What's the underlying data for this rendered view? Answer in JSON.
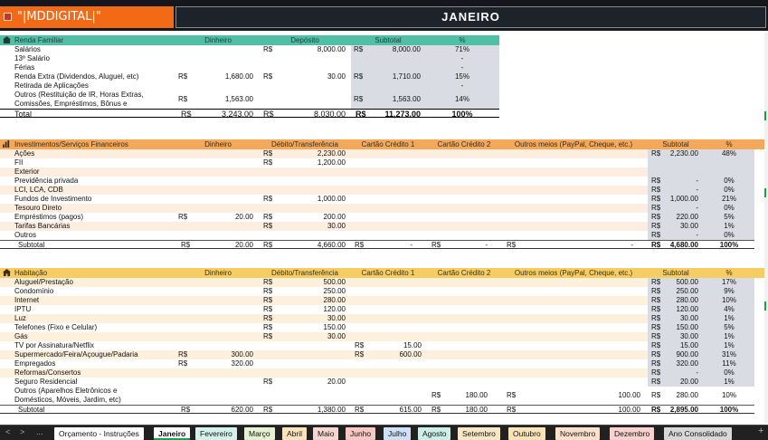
{
  "header": {
    "brand": "\"|MDDIGITAL|\"",
    "month": "JANEIRO"
  },
  "renda": {
    "title": "Renda Familiar",
    "columns": {
      "dinheiro": "Dinheiro",
      "deposito": "Depósito",
      "subtotal": "Subtotal",
      "pct": "%"
    },
    "rows": [
      {
        "label": "Salários",
        "din_cur": "",
        "din": "",
        "dep_cur": "R$",
        "dep": "8,000.00",
        "sub_cur": "R$",
        "sub": "8,000.00",
        "pct": "71%"
      },
      {
        "label": "13º Salário",
        "din_cur": "",
        "din": "",
        "dep_cur": "",
        "dep": "",
        "sub_cur": "",
        "sub": "",
        "pct": "-"
      },
      {
        "label": "Férias",
        "din_cur": "",
        "din": "",
        "dep_cur": "",
        "dep": "",
        "sub_cur": "",
        "sub": "",
        "pct": "-"
      },
      {
        "label": "Renda Extra (Dividendos, Aluguel, etc)",
        "din_cur": "R$",
        "din": "1,680.00",
        "dep_cur": "R$",
        "dep": "30.00",
        "sub_cur": "R$",
        "sub": "1,710.00",
        "pct": "15%"
      },
      {
        "label": "Retirada de Aplicações",
        "din_cur": "",
        "din": "",
        "dep_cur": "",
        "dep": "",
        "sub_cur": "",
        "sub": "",
        "pct": "-"
      }
    ],
    "outros": {
      "line1": "Outros (Restituição de IR, Horas Extras,",
      "line2": "Comissões, Empréstimos, Bônus e",
      "din_cur": "R$",
      "din": "1,563.00",
      "sub_cur": "R$",
      "sub": "1,563.00",
      "pct": "14%"
    },
    "total": {
      "label": "Total",
      "din_cur": "R$",
      "din": "3,243.00",
      "dep_cur": "R$",
      "dep": "8,030.00",
      "sub_cur": "R$",
      "sub": "11,273.00",
      "pct": "100%"
    }
  },
  "invest": {
    "title": "Investimentos/Serviços Financeiros",
    "columns": {
      "dinheiro": "Dinheiro",
      "debito": "Débito/Transferência",
      "cc1": "Cartão Crédito 1",
      "cc2": "Cartão Crédito 2",
      "outros": "Outros meios (PayPal, Cheque, etc.)",
      "subtotal": "Subtotal",
      "pct": "%"
    },
    "rows": [
      {
        "label": "Ações",
        "din_cur": "",
        "din": "",
        "deb_cur": "R$",
        "deb": "2,230.00",
        "sub_cur": "R$",
        "sub": "2,230.00",
        "pct": "48%"
      },
      {
        "label": "FII",
        "din_cur": "",
        "din": "",
        "deb_cur": "R$",
        "deb": "1,200.00",
        "sub_cur": "",
        "sub": "",
        "pct": ""
      },
      {
        "label": "Exterior",
        "din_cur": "",
        "din": "",
        "deb_cur": "",
        "deb": "",
        "sub_cur": "",
        "sub": "",
        "pct": ""
      },
      {
        "label": "Previdência privada",
        "din_cur": "",
        "din": "",
        "deb_cur": "",
        "deb": "",
        "sub_cur": "R$",
        "sub": "-",
        "pct": "0%"
      },
      {
        "label": "LCI, LCA, CDB",
        "din_cur": "",
        "din": "",
        "deb_cur": "",
        "deb": "",
        "sub_cur": "R$",
        "sub": "-",
        "pct": "0%"
      },
      {
        "label": "Fundos de Investimento",
        "din_cur": "",
        "din": "",
        "deb_cur": "R$",
        "deb": "1,000.00",
        "sub_cur": "R$",
        "sub": "1,000.00",
        "pct": "21%"
      },
      {
        "label": "Tesouro Direto",
        "din_cur": "",
        "din": "",
        "deb_cur": "",
        "deb": "",
        "sub_cur": "R$",
        "sub": "-",
        "pct": "0%"
      },
      {
        "label": "Empréstimos (pagos)",
        "din_cur": "R$",
        "din": "20.00",
        "deb_cur": "R$",
        "deb": "200.00",
        "sub_cur": "R$",
        "sub": "220.00",
        "pct": "5%"
      },
      {
        "label": "Tarifas Bancárias",
        "din_cur": "",
        "din": "",
        "deb_cur": "R$",
        "deb": "30.00",
        "sub_cur": "R$",
        "sub": "30.00",
        "pct": "1%"
      },
      {
        "label": "Outros",
        "din_cur": "",
        "din": "",
        "deb_cur": "",
        "deb": "",
        "sub_cur": "R$",
        "sub": "-",
        "pct": "0%"
      }
    ],
    "subtotal": {
      "label": "Subtotal",
      "din_cur": "R$",
      "din": "20.00",
      "deb_cur": "R$",
      "deb": "4,660.00",
      "cc1_cur": "R$",
      "cc1": "-",
      "cc2_cur": "R$",
      "cc2": "-",
      "out_cur": "R$",
      "out": "-",
      "sub_cur": "R$",
      "sub": "4,680.00",
      "pct": "100%"
    }
  },
  "hab": {
    "title": "Habitação",
    "columns": {
      "dinheiro": "Dinheiro",
      "debito": "Débito/Transferência",
      "cc1": "Cartão Crédito 1",
      "cc2": "Cartão Crédito 2",
      "outros": "Outros meios (PayPal, Cheque, etc.)",
      "subtotal": "Subtotal",
      "pct": "%"
    },
    "rows": [
      {
        "label": "Aluguel/Prestação",
        "din_cur": "",
        "din": "",
        "deb_cur": "R$",
        "deb": "500.00",
        "cc1_cur": "",
        "cc1": "",
        "sub_cur": "R$",
        "sub": "500.00",
        "pct": "17%"
      },
      {
        "label": "Condomínio",
        "din_cur": "",
        "din": "",
        "deb_cur": "R$",
        "deb": "250.00",
        "cc1_cur": "",
        "cc1": "",
        "sub_cur": "R$",
        "sub": "250.00",
        "pct": "9%"
      },
      {
        "label": "Internet",
        "din_cur": "",
        "din": "",
        "deb_cur": "R$",
        "deb": "280.00",
        "cc1_cur": "",
        "cc1": "",
        "sub_cur": "R$",
        "sub": "280.00",
        "pct": "10%"
      },
      {
        "label": "IPTU",
        "din_cur": "",
        "din": "",
        "deb_cur": "R$",
        "deb": "120.00",
        "cc1_cur": "",
        "cc1": "",
        "sub_cur": "R$",
        "sub": "120.00",
        "pct": "4%"
      },
      {
        "label": "Luz",
        "din_cur": "",
        "din": "",
        "deb_cur": "R$",
        "deb": "30.00",
        "cc1_cur": "",
        "cc1": "",
        "sub_cur": "R$",
        "sub": "30.00",
        "pct": "1%"
      },
      {
        "label": "Telefones (Fixo e Celular)",
        "din_cur": "",
        "din": "",
        "deb_cur": "R$",
        "deb": "150.00",
        "cc1_cur": "",
        "cc1": "",
        "sub_cur": "R$",
        "sub": "150.00",
        "pct": "5%"
      },
      {
        "label": "Gás",
        "din_cur": "",
        "din": "",
        "deb_cur": "R$",
        "deb": "30.00",
        "cc1_cur": "",
        "cc1": "",
        "sub_cur": "R$",
        "sub": "30.00",
        "pct": "1%"
      },
      {
        "label": "TV por Assinatura/Netflix",
        "din_cur": "",
        "din": "",
        "deb_cur": "",
        "deb": "",
        "cc1_cur": "R$",
        "cc1": "15.00",
        "sub_cur": "R$",
        "sub": "15.00",
        "pct": "1%"
      },
      {
        "label": "Supermercado/Feira/Açougue/Padaria",
        "din_cur": "R$",
        "din": "300.00",
        "deb_cur": "",
        "deb": "",
        "cc1_cur": "R$",
        "cc1": "600.00",
        "sub_cur": "R$",
        "sub": "900.00",
        "pct": "31%"
      },
      {
        "label": "Empregados",
        "din_cur": "R$",
        "din": "320.00",
        "deb_cur": "",
        "deb": "",
        "cc1_cur": "",
        "cc1": "",
        "sub_cur": "R$",
        "sub": "320.00",
        "pct": "11%"
      },
      {
        "label": "Reformas/Consertos",
        "din_cur": "",
        "din": "",
        "deb_cur": "",
        "deb": "",
        "cc1_cur": "",
        "cc1": "",
        "sub_cur": "R$",
        "sub": "-",
        "pct": "0%"
      },
      {
        "label": "Seguro Residencial",
        "din_cur": "",
        "din": "",
        "deb_cur": "R$",
        "deb": "20.00",
        "cc1_cur": "",
        "cc1": "",
        "sub_cur": "R$",
        "sub": "20.00",
        "pct": "1%"
      }
    ],
    "outros": {
      "line1": "Outros (Aparelhos Eletrônicos e",
      "line2": "Domésticos, Móveis, Jardim, etc)",
      "cc2_cur": "R$",
      "cc2": "180.00",
      "out_cur": "R$",
      "out": "100.00",
      "sub_cur": "R$",
      "sub": "280.00",
      "pct": "10%"
    },
    "subtotal": {
      "label": "Subtotal",
      "din_cur": "R$",
      "din": "620.00",
      "deb_cur": "R$",
      "deb": "1,380.00",
      "cc1_cur": "R$",
      "cc1": "615.00",
      "cc2_cur": "R$",
      "cc2": "180.00",
      "out_cur": "R$",
      "out": "100.00",
      "sub_cur": "R$",
      "sub": "2,895.00",
      "pct": "100%"
    }
  },
  "tabs": [
    {
      "label": "Orçamento - Instruções",
      "color": "#ffffff"
    },
    {
      "label": "Janeiro",
      "color": "#ffffff"
    },
    {
      "label": "Fevereiro",
      "color": "#d4f2ea"
    },
    {
      "label": "Março",
      "color": "#e6f0d2"
    },
    {
      "label": "Abril",
      "color": "#fbe3c0"
    },
    {
      "label": "Maio",
      "color": "#f7d6d2"
    },
    {
      "label": "Junho",
      "color": "#f7c7c3"
    },
    {
      "label": "Julho",
      "color": "#cfe0f7"
    },
    {
      "label": "Agosto",
      "color": "#cdeee6"
    },
    {
      "label": "Setembro",
      "color": "#f7e7c6"
    },
    {
      "label": "Outubro",
      "color": "#fae3b9"
    },
    {
      "label": "Novembro",
      "color": "#fbe0cc"
    },
    {
      "label": "Dezembro",
      "color": "#f9d2cf"
    },
    {
      "label": "Ano Consolidado",
      "color": "#d7d7d7"
    }
  ],
  "nav": {
    "prev": "<",
    "next": ">",
    "more": "..."
  },
  "colors": {
    "teal": "#4fbfa6",
    "orange": "#f4a85a",
    "yellow": "#f6cd63",
    "brand": "#f26a16",
    "header_bg": "#1d232a"
  }
}
